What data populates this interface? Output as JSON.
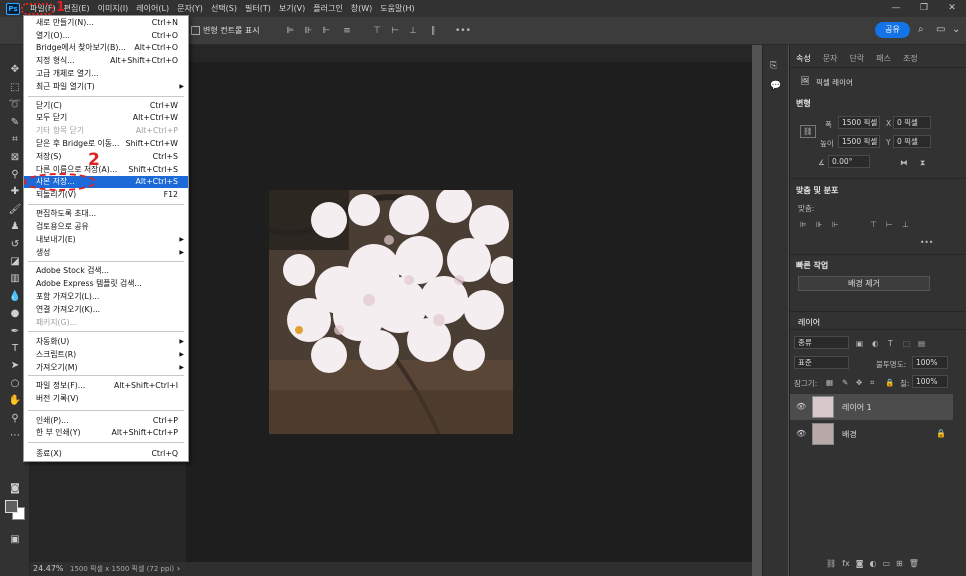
{
  "menubar": {
    "logo": "Ps",
    "items": [
      "파일(F)",
      "편집(E)",
      "이미지(I)",
      "레이어(L)",
      "문자(Y)",
      "선택(S)",
      "필터(T)",
      "보기(V)",
      "플러그인",
      "창(W)",
      "도움말(H)"
    ],
    "window_controls": [
      "—",
      "❐",
      "✕"
    ]
  },
  "options": {
    "transform_label": "변형 컨트롤 표시",
    "share_label": "공유",
    "more_icon": "•••"
  },
  "file_menu": {
    "items": [
      {
        "label": "새로 만들기(N)...",
        "shortcut": "Ctrl+N"
      },
      {
        "label": "열기(O)...",
        "shortcut": "Ctrl+O"
      },
      {
        "label": "Bridge에서 찾아보기(B)...",
        "shortcut": "Alt+Ctrl+O"
      },
      {
        "label": "지정 형식...",
        "shortcut": "Alt+Shift+Ctrl+O"
      },
      {
        "label": "고급 개체로 열기...",
        "shortcut": ""
      },
      {
        "label": "최근 파일 열기(T)",
        "shortcut": "",
        "submenu": true
      },
      {
        "label": "닫기(C)",
        "shortcut": "Ctrl+W"
      },
      {
        "label": "모두 닫기",
        "shortcut": "Alt+Ctrl+W"
      },
      {
        "label": "기타 항목 닫기",
        "shortcut": "Alt+Ctrl+P",
        "disabled": true
      },
      {
        "label": "닫은 후 Bridge로 이동...",
        "shortcut": "Shift+Ctrl+W"
      },
      {
        "label": "저장(S)",
        "shortcut": "Ctrl+S"
      },
      {
        "label": "다른 이름으로 저장(A)...",
        "shortcut": "Shift+Ctrl+S"
      },
      {
        "label": "사본 저장...",
        "shortcut": "Alt+Ctrl+S",
        "highlight": true
      },
      {
        "label": "되돌리기(V)",
        "shortcut": "F12"
      },
      {
        "label": "편집하도록 초대...",
        "shortcut": ""
      },
      {
        "label": "검토용으로 공유",
        "shortcut": ""
      },
      {
        "label": "내보내기(E)",
        "shortcut": "",
        "submenu": true
      },
      {
        "label": "생성",
        "shortcut": "",
        "submenu": true
      },
      {
        "label": "Adobe Stock 검색...",
        "shortcut": ""
      },
      {
        "label": "Adobe Express 템플릿 검색...",
        "shortcut": ""
      },
      {
        "label": "포함 가져오기(L)...",
        "shortcut": ""
      },
      {
        "label": "연결 가져오기(K)...",
        "shortcut": ""
      },
      {
        "label": "패키지(G)...",
        "shortcut": "",
        "disabled": true
      },
      {
        "label": "자동화(U)",
        "shortcut": "",
        "submenu": true
      },
      {
        "label": "스크립트(R)",
        "shortcut": "",
        "submenu": true
      },
      {
        "label": "가져오기(M)",
        "shortcut": "",
        "submenu": true
      },
      {
        "label": "파일 정보(F)...",
        "shortcut": "Alt+Shift+Ctrl+I"
      },
      {
        "label": "버전 기록(V)",
        "shortcut": ""
      },
      {
        "label": "인쇄(P)...",
        "shortcut": "Ctrl+P"
      },
      {
        "label": "한 부 인쇄(Y)",
        "shortcut": "Alt+Shift+Ctrl+P"
      },
      {
        "label": "종료(X)",
        "shortcut": "Ctrl+Q"
      }
    ]
  },
  "annotations": {
    "step1": "1",
    "step2": "2"
  },
  "status": {
    "zoom": "24.47%",
    "doc_info": "1500 픽셀 x 1500 픽셀 (72 ppi)",
    "arrow": "›"
  },
  "panel": {
    "tabs": [
      "속성",
      "문자",
      "단락",
      "패스",
      "조정"
    ],
    "layer_kind": "픽셀 레이어",
    "transform_title": "변형",
    "w_label": "폭",
    "w_value": "1500 픽셀",
    "h_label": "높이",
    "h_value": "1500 픽셀",
    "x_label": "X",
    "x_value": "0 픽셀",
    "y_label": "Y",
    "y_value": "0 픽셀",
    "angle_value": "0.00°",
    "align_title": "맞춤 및 분포",
    "align_label": "맞춤:",
    "quick_title": "빠른 작업",
    "remove_bg": "배경 제거",
    "layers_tab": "레이어",
    "filter_kind": "종류",
    "blend_mode": "표준",
    "opacity_label": "불투명도:",
    "opacity_value": "100%",
    "lock_label": "잠그기:",
    "fill_label": "칠:",
    "fill_value": "100%",
    "layers": [
      {
        "name": "레이어 1",
        "selected": true
      },
      {
        "name": "배경",
        "locked": true
      }
    ]
  },
  "colors": {
    "accent": "#1473e6",
    "highlight": "#1c6ad8",
    "annotation": "#e02020"
  }
}
